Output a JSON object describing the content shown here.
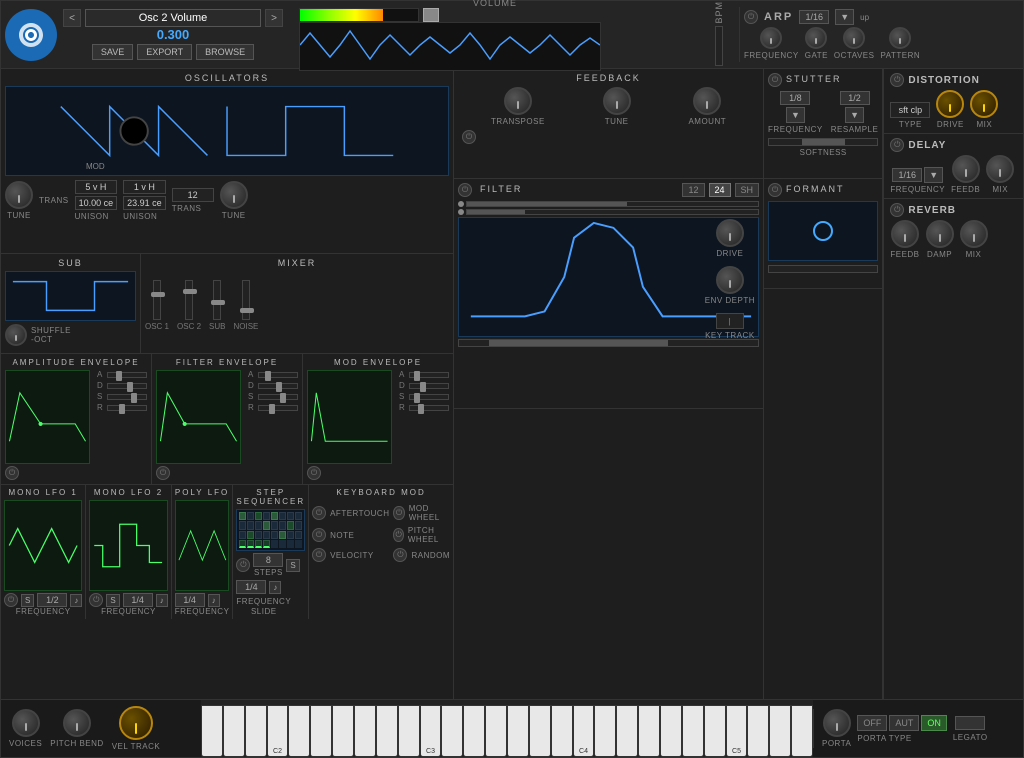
{
  "header": {
    "preset_name": "Osc 2 Volume",
    "preset_value": "0.300",
    "save_label": "SAVE",
    "export_label": "EXPORT",
    "browse_label": "BROWSE",
    "volume_label": "VOLUME",
    "bpm_label": "BPM",
    "arp_label": "ARP",
    "frequency_label": "FREQUENCY",
    "gate_label": "GATE",
    "octaves_label": "OCTAVES",
    "pattern_label": "PATTERN",
    "arp_freq": "1/16",
    "arp_up": "up"
  },
  "oscillators": {
    "title": "OSCILLATORS",
    "mod_label": "MOD",
    "tune_label": "TUNE",
    "trans_label": "TRANS",
    "unison_label": "UNISON",
    "osc1": {
      "h_val": "5 v H",
      "tune_val": "10.00 ce"
    },
    "osc2": {
      "h_val": "1 v H",
      "tune_val": "23.91 ce",
      "trans_val": "12"
    }
  },
  "sub": {
    "title": "SUB",
    "shuffle_label": "SHUFFLE",
    "oct_label": "-OCT"
  },
  "mixer": {
    "title": "MIXER",
    "osc1_label": "OSC 1",
    "osc2_label": "OSC 2",
    "sub_label": "SUB",
    "noise_label": "NOISE"
  },
  "feedback": {
    "title": "FEEDBACK",
    "transpose_label": "TRANSPOSE",
    "tune_label": "TUNE",
    "amount_label": "AMOUNT"
  },
  "filter": {
    "title": "FILTER",
    "type_12": "12",
    "type_24": "24",
    "type_sh": "SH",
    "drive_label": "DRIVE",
    "env_depth_label": "ENV DEPTH",
    "key_track_label": "KEY TRACK"
  },
  "stutter": {
    "title": "STUTTER",
    "freq_label": "FREQUENCY",
    "resample_label": "RESAMPLE",
    "softness_label": "SOFTNESS",
    "freq_val": "1/8",
    "resample_val": "1/2"
  },
  "formant": {
    "title": "FORMANT"
  },
  "distortion": {
    "title": "DISTORTION",
    "type_label": "TYPE",
    "drive_label": "DRIVE",
    "mix_label": "MIX",
    "type_val": "sft clp"
  },
  "delay": {
    "title": "DELAY",
    "freq_label": "FREQUENCY",
    "feedb_label": "FEEDB",
    "mix_label": "MIX",
    "freq_val": "1/16"
  },
  "reverb": {
    "title": "REVERB",
    "feedb_label": "FEEDB",
    "damp_label": "DAMP",
    "mix_label": "MIX"
  },
  "amp_env": {
    "title": "AMPLITUDE ENVELOPE",
    "a_label": "A",
    "d_label": "D",
    "s_label": "S",
    "r_label": "R"
  },
  "filter_env": {
    "title": "FILTER ENVELOPE",
    "a_label": "A",
    "d_label": "D",
    "s_label": "S",
    "r_label": "R"
  },
  "mod_env": {
    "title": "MOD ENVELOPE",
    "a_label": "A",
    "d_label": "D",
    "s_label": "S",
    "r_label": "R"
  },
  "lfo1": {
    "title": "MONO LFO 1",
    "freq_label": "FREQUENCY",
    "sync_val": "1/2"
  },
  "lfo2": {
    "title": "MONO LFO 2",
    "freq_label": "FREQUENCY",
    "sync_val": "1/4"
  },
  "poly_lfo": {
    "title": "POLY LFO",
    "freq_label": "FREQUENCY",
    "sync_val": "1/4"
  },
  "step_seq": {
    "title": "STEP SEQUENCER",
    "steps_label": "STEPS",
    "freq_label": "FREQUENCY",
    "slide_label": "SLIDE",
    "steps_val": "8",
    "sync_val": "1/4"
  },
  "kbd_mod": {
    "title": "KEYBOARD MOD",
    "aftertouch_label": "AFTERTOUCH",
    "note_label": "NOTE",
    "velocity_label": "VELOCITY",
    "mod_wheel_label": "MOD WHEEL",
    "pitch_wheel_label": "PITCH WHEEL",
    "random_label": "RANDOM"
  },
  "bottom": {
    "voices_label": "VOICES",
    "pitch_bend_label": "PITCH BEND",
    "vel_track_label": "VEL TRACK",
    "porta_label": "PORTA",
    "porta_type_label": "PORTA TYPE",
    "legato_label": "LEGATO",
    "off_label": "OFF",
    "aut_label": "AUT",
    "on_label": "ON",
    "c2": "C2",
    "c3": "C3",
    "c4": "C4",
    "c5": "C5"
  },
  "colors": {
    "accent_blue": "#4a9eff",
    "accent_green": "#4aff6a",
    "accent_gold": "#ffd700",
    "bg_dark": "#1e1e1e",
    "bg_panel": "#252525",
    "osc_line": "#4a9eff",
    "env_line": "#4aff6a"
  }
}
